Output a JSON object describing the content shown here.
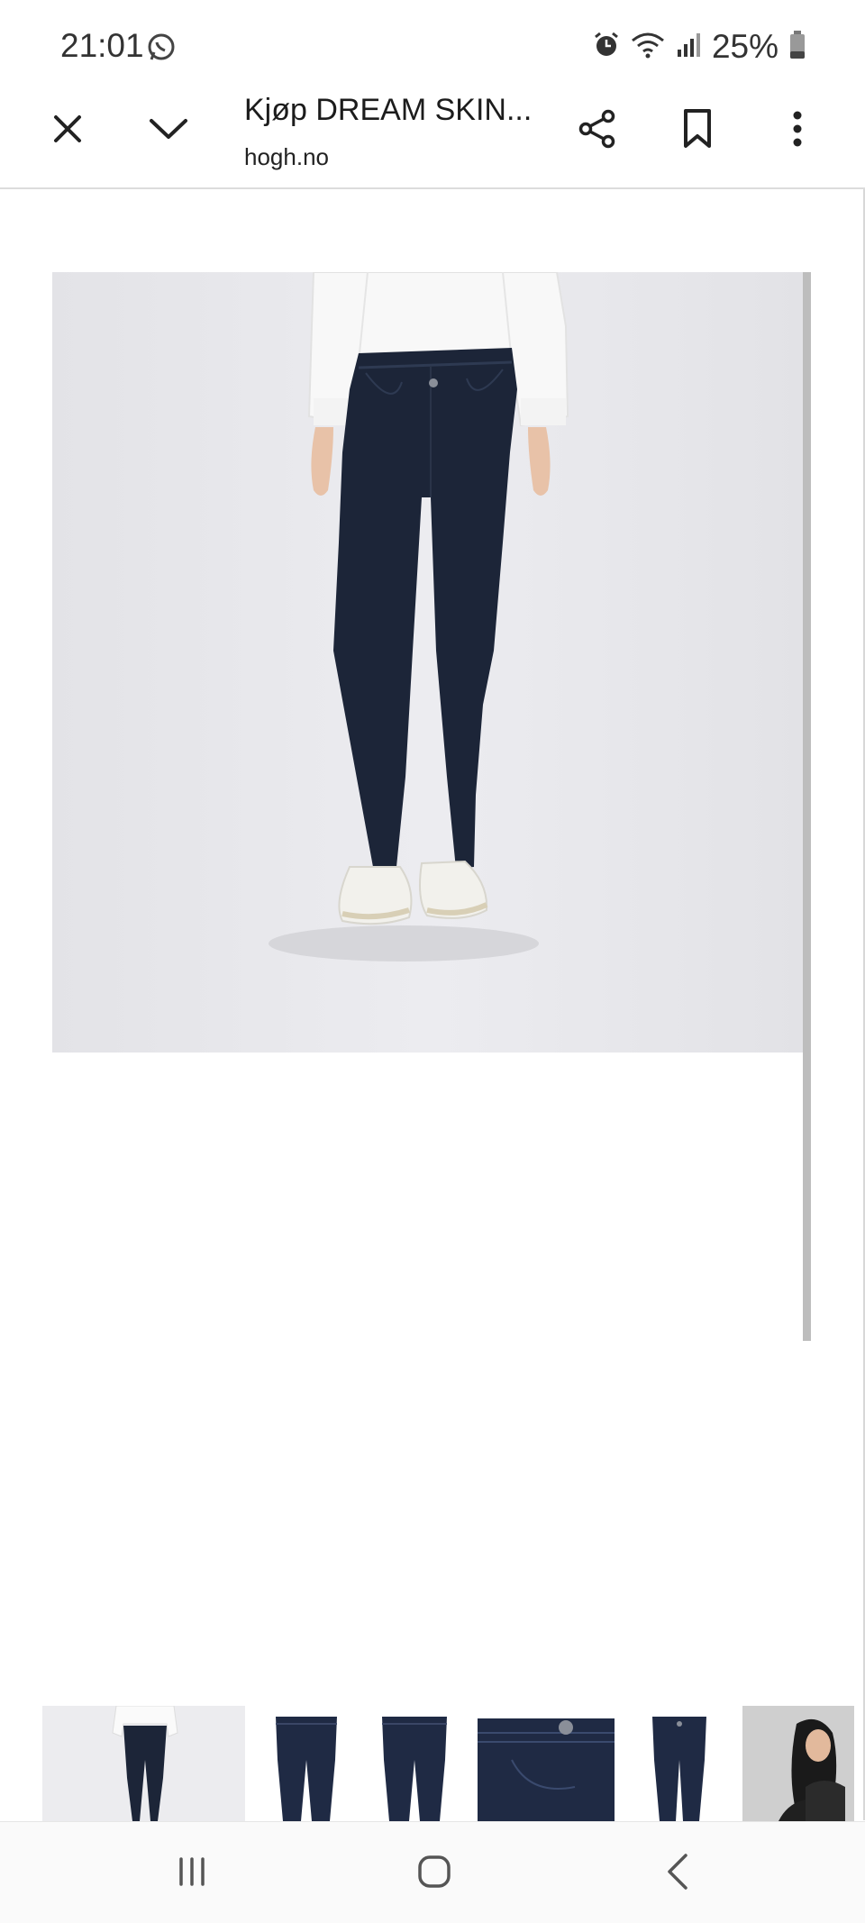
{
  "status_bar": {
    "time": "21:01",
    "battery_percent": "25%",
    "icons": [
      "whatsapp-icon",
      "alarm-icon",
      "wifi-icon",
      "signal-icon",
      "battery-icon"
    ]
  },
  "browser": {
    "title": "Kjøp DREAM SKIN...",
    "url": "hogh.no",
    "actions": [
      "close-icon",
      "chevron-down-icon",
      "share-icon",
      "bookmark-icon",
      "more-vert-icon"
    ]
  },
  "product": {
    "main_image": "woman-in-dark-skinny-jeans-and-white-shirt",
    "thumbnails": [
      "front-full-view",
      "jeans-front",
      "jeans-back",
      "waistband-detail",
      "jeans-side",
      "model-lifestyle"
    ]
  },
  "navigation": [
    "recent-apps-icon",
    "home-icon",
    "back-icon"
  ],
  "colors": {
    "denim": "#1c2538",
    "background": "#e8e8ec",
    "shirt": "#f7f7f7"
  }
}
